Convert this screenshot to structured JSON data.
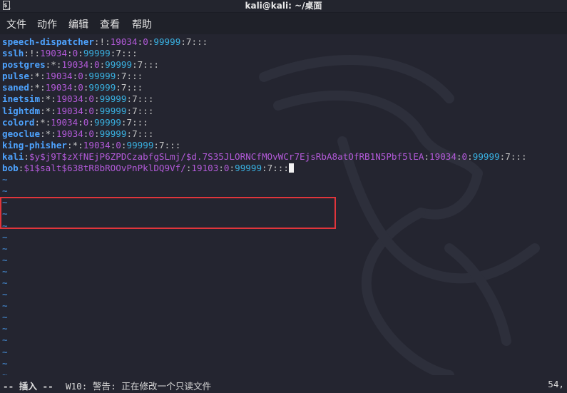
{
  "window": {
    "title": "kali@kali: ~/桌面",
    "icon": "terminal-icon"
  },
  "menu": [
    {
      "label": "文件"
    },
    {
      "label": "动作"
    },
    {
      "label": "编辑"
    },
    {
      "label": "查看"
    },
    {
      "label": "帮助"
    }
  ],
  "shadow_lines": [
    {
      "user": "speech-dispatcher",
      "hash": "!",
      "date": "19034",
      "min": "0",
      "max": "99999",
      "warn": "7",
      "rest": ":::"
    },
    {
      "user": "sslh",
      "hash": "!",
      "date": "19034",
      "min": "0",
      "max": "99999",
      "warn": "7",
      "rest": ":::"
    },
    {
      "user": "postgres",
      "hash": "*",
      "date": "19034",
      "min": "0",
      "max": "99999",
      "warn": "7",
      "rest": ":::"
    },
    {
      "user": "pulse",
      "hash": "*",
      "date": "19034",
      "min": "0",
      "max": "99999",
      "warn": "7",
      "rest": ":::"
    },
    {
      "user": "saned",
      "hash": "*",
      "date": "19034",
      "min": "0",
      "max": "99999",
      "warn": "7",
      "rest": ":::"
    },
    {
      "user": "inetsim",
      "hash": "*",
      "date": "19034",
      "min": "0",
      "max": "99999",
      "warn": "7",
      "rest": ":::"
    },
    {
      "user": "lightdm",
      "hash": "*",
      "date": "19034",
      "min": "0",
      "max": "99999",
      "warn": "7",
      "rest": ":::"
    },
    {
      "user": "colord",
      "hash": "*",
      "date": "19034",
      "min": "0",
      "max": "99999",
      "warn": "7",
      "rest": ":::"
    },
    {
      "user": "geoclue",
      "hash": "*",
      "date": "19034",
      "min": "0",
      "max": "99999",
      "warn": "7",
      "rest": ":::"
    },
    {
      "user": "king-phisher",
      "hash": "*",
      "date": "19034",
      "min": "0",
      "max": "99999",
      "warn": "7",
      "rest": ":::"
    },
    {
      "user": "kali",
      "hash": "$y$j9T$zXfNEjP6ZPDCzabfgSLmj/$d.7S35JLORNCfMOvWCr7EjsRbA8atOfRB1N5Pbf5lEA",
      "date": "19034",
      "min": "0",
      "max": "99999",
      "warn": "7",
      "rest": ":::"
    },
    {
      "user": "bob",
      "hash": "$1$salt$638tR8bROOvPnPklDQ9Vf/",
      "date": "19103",
      "min": "0",
      "max": "99999",
      "warn": "7",
      "rest": ":::"
    }
  ],
  "tilde_char": "~",
  "tilde_count": 18,
  "status": {
    "mode": "-- 插入 --",
    "warning": "W10: 警告: 正在修改一个只读文件",
    "position": "54,"
  },
  "colors": {
    "username": "#4ea3ff",
    "hash": "#b35ad9",
    "number": "#39b0e0",
    "highlight_border": "#e0353b",
    "background": "#242530"
  },
  "decor": {
    "background_logo": "kali-dragon-icon"
  }
}
